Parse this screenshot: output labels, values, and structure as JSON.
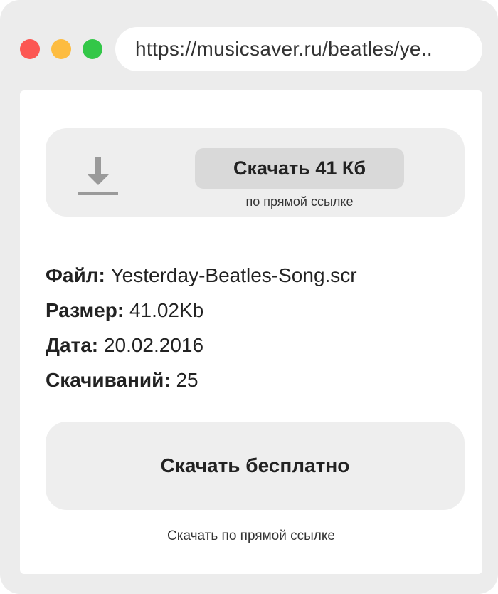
{
  "window": {
    "controls": [
      "close",
      "minimize",
      "maximize"
    ],
    "colors": {
      "close": "#fc5753",
      "minimize": "#fdbc40",
      "maximize": "#33c748"
    }
  },
  "address_bar": {
    "url": "https://musicsaver.ru/beatles/ye.."
  },
  "direct_download": {
    "icon": "download-icon",
    "button_label": "Скачать 41 Кб",
    "subtitle": "по прямой ссылке"
  },
  "file_info": {
    "file_label": "Файл:",
    "file_value": "Yesterday-Beatles-Song.scr",
    "size_label": "Размер:",
    "size_value": "41.02Kb",
    "date_label": "Дата:",
    "date_value": "20.02.2016",
    "downloads_label": "Скачиваний:",
    "downloads_value": "25"
  },
  "free_download_button": "Скачать бесплатно",
  "direct_link_text": "Скачать по прямой ссылке"
}
